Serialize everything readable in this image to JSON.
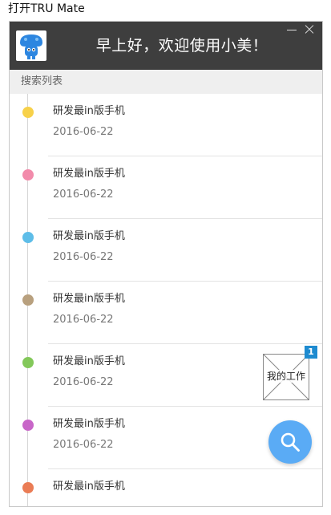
{
  "caption": "打开TRU Mate",
  "header": {
    "greeting": "早上好，欢迎使用小美！",
    "avatar_icon": "robot-mascot-icon",
    "minimize_icon": "minimize-icon",
    "close_icon": "close-icon"
  },
  "section": {
    "title": "搜索列表"
  },
  "items": [
    {
      "title": "研发最in版手机",
      "date": "2016-06-22",
      "color": "#f7d14a"
    },
    {
      "title": "研发最in版手机",
      "date": "2016-06-22",
      "color": "#f28bab"
    },
    {
      "title": "研发最in版手机",
      "date": "2016-06-22",
      "color": "#5ebde8"
    },
    {
      "title": "研发最in版手机",
      "date": "2016-06-22",
      "color": "#b8a07e"
    },
    {
      "title": "研发最in版手机",
      "date": "2016-06-22",
      "color": "#83c85a"
    },
    {
      "title": "研发最in版手机",
      "date": "2016-06-22",
      "color": "#c866c8"
    },
    {
      "title": "研发最in版手机",
      "date": "",
      "color": "#ea7c55"
    }
  ],
  "my_work": {
    "label": "我的工作",
    "badge": "1"
  },
  "search_fab": {
    "icon": "search-icon",
    "color": "#5aabf5"
  }
}
